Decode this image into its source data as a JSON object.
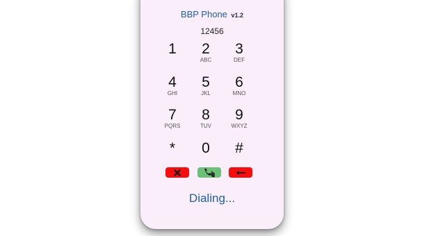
{
  "app": {
    "title": "BBP Phone",
    "version": "v1.2"
  },
  "display": {
    "number": "12456"
  },
  "keypad": [
    {
      "digit": "1",
      "letters": ""
    },
    {
      "digit": "2",
      "letters": "ABC"
    },
    {
      "digit": "3",
      "letters": "DEF"
    },
    {
      "digit": "4",
      "letters": "GHI"
    },
    {
      "digit": "5",
      "letters": "JKL"
    },
    {
      "digit": "6",
      "letters": "MNO"
    },
    {
      "digit": "7",
      "letters": "PQRS"
    },
    {
      "digit": "8",
      "letters": "TUV"
    },
    {
      "digit": "9",
      "letters": "WXYZ"
    },
    {
      "digit": "*",
      "letters": ""
    },
    {
      "digit": "0",
      "letters": ""
    },
    {
      "digit": "#",
      "letters": ""
    }
  ],
  "actions": {
    "clear_icon": "x-icon",
    "call_icon": "phone-icon",
    "backspace_icon": "left-arrow-icon"
  },
  "status": {
    "text": "Dialing..."
  },
  "colors": {
    "panel_bg": "#fbeefb",
    "accent_blue": "#1f5fa8",
    "red": "#f60e0e",
    "green": "#6cbf76"
  }
}
